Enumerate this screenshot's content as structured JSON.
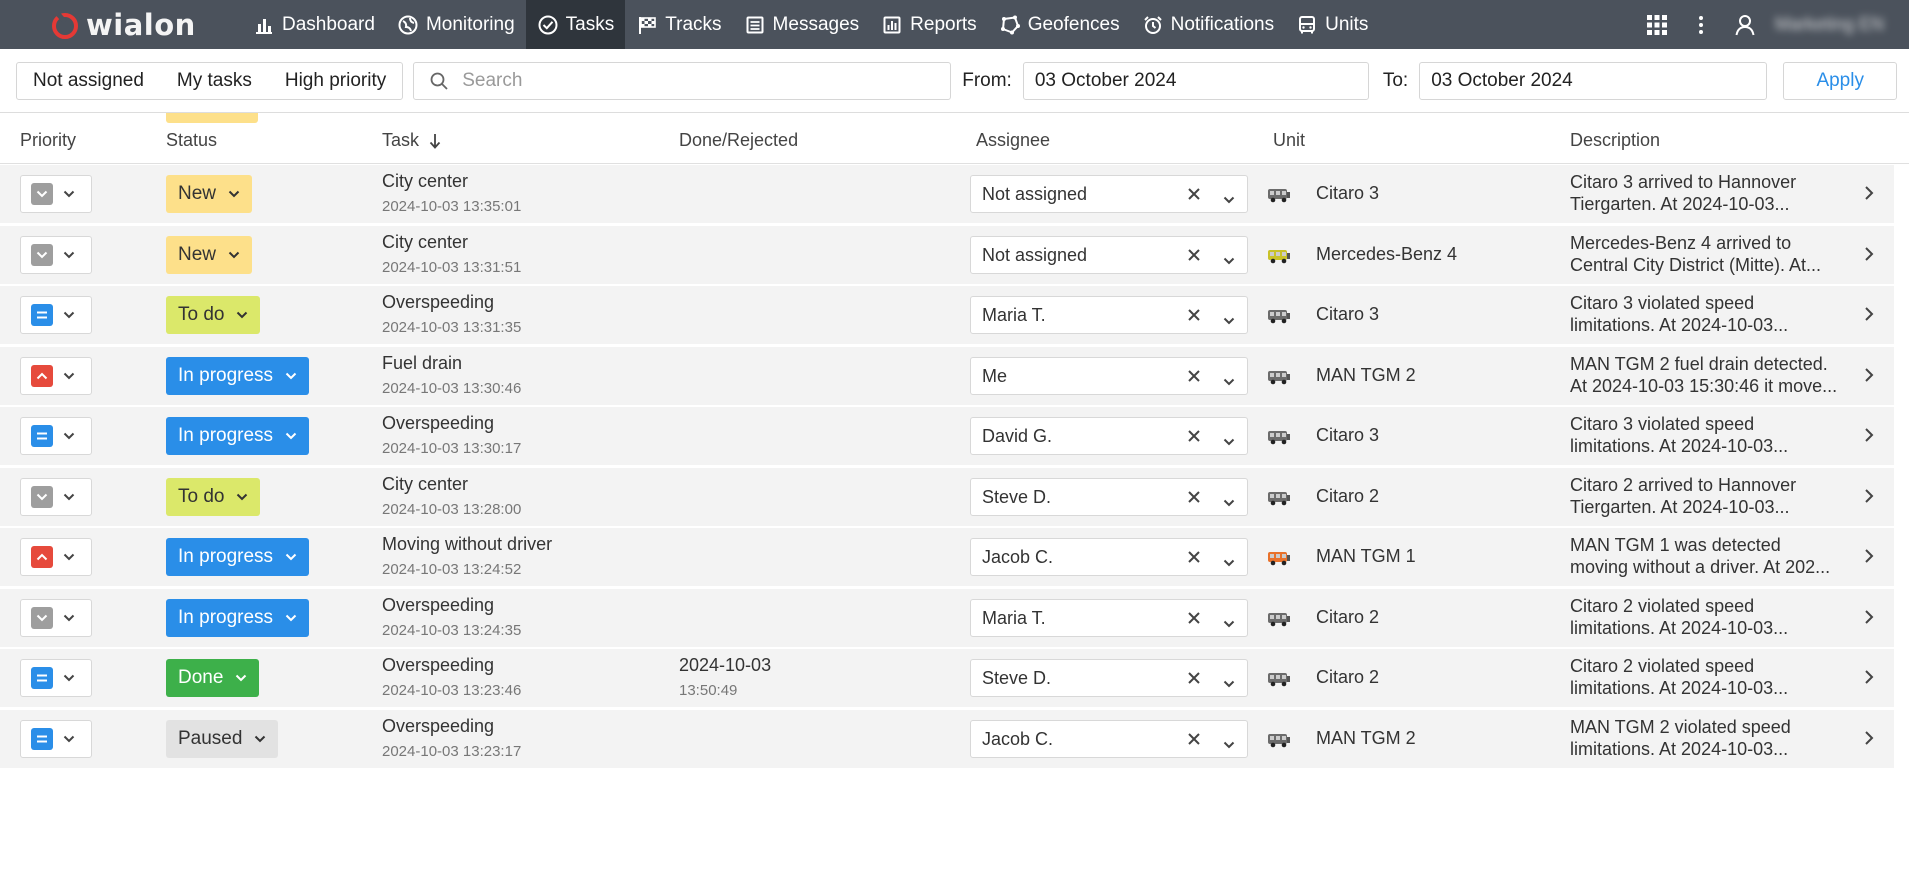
{
  "app": {
    "logo_text": "wialon",
    "nav": [
      {
        "label": "Dashboard",
        "icon": "dashboard-icon"
      },
      {
        "label": "Monitoring",
        "icon": "globe-icon"
      },
      {
        "label": "Tasks",
        "icon": "check-circle-icon"
      },
      {
        "label": "Tracks",
        "icon": "checkered-flag-icon"
      },
      {
        "label": "Messages",
        "icon": "messages-icon"
      },
      {
        "label": "Reports",
        "icon": "reports-icon"
      },
      {
        "label": "Geofences",
        "icon": "geofence-icon"
      },
      {
        "label": "Notifications",
        "icon": "alarm-clock-icon"
      },
      {
        "label": "Units",
        "icon": "bus-icon"
      }
    ],
    "active_nav": "Tasks",
    "user_name": "Marketing EN"
  },
  "filters": {
    "quick": [
      "Not assigned",
      "My tasks",
      "High priority"
    ],
    "search_placeholder": "Search",
    "from_label": "From:",
    "from_value": "03 October 2024",
    "to_label": "To:",
    "to_value": "03 October 2024",
    "apply_label": "Apply"
  },
  "table": {
    "columns": {
      "priority": "Priority",
      "status": "Status",
      "task": "Task",
      "done": "Done/Rejected",
      "assignee": "Assignee",
      "unit": "Unit",
      "description": "Description"
    },
    "sort_column": "Task",
    "sort_direction": "descending",
    "rows": [
      {
        "priority": "low",
        "status": "New",
        "task": "City center",
        "date": "2024-10-03 13:35:01",
        "done_date": "",
        "done_time": "",
        "assignee": "Not assigned",
        "unit": "Citaro 3",
        "desc1": "Citaro 3 arrived to Hannover",
        "desc2": "Tiergarten. At 2024-10-03..."
      },
      {
        "priority": "low",
        "status": "New",
        "task": "City center",
        "date": "2024-10-03 13:31:51",
        "done_date": "",
        "done_time": "",
        "assignee": "Not assigned",
        "unit": "Mercedes-Benz 4",
        "desc1": "Mercedes-Benz 4 arrived to",
        "desc2": "Central City District (Mitte). At..."
      },
      {
        "priority": "medium",
        "status": "To do",
        "task": "Overspeeding",
        "date": "2024-10-03 13:31:35",
        "done_date": "",
        "done_time": "",
        "assignee": "Maria T.",
        "unit": "Citaro 3",
        "desc1": "Citaro 3 violated speed",
        "desc2": "limitations. At 2024-10-03..."
      },
      {
        "priority": "high",
        "status": "In progress",
        "task": "Fuel drain",
        "date": "2024-10-03 13:30:46",
        "done_date": "",
        "done_time": "",
        "assignee": "Me",
        "unit": "MAN TGM 2",
        "desc1": "MAN TGM 2 fuel drain detected.",
        "desc2": "At 2024-10-03 15:30:46 it move..."
      },
      {
        "priority": "medium",
        "status": "In progress",
        "task": "Overspeeding",
        "date": "2024-10-03 13:30:17",
        "done_date": "",
        "done_time": "",
        "assignee": "David G.",
        "unit": "Citaro 3",
        "desc1": "Citaro 3 violated speed",
        "desc2": "limitations. At 2024-10-03..."
      },
      {
        "priority": "low",
        "status": "To do",
        "task": "City center",
        "date": "2024-10-03 13:28:00",
        "done_date": "",
        "done_time": "",
        "assignee": "Steve D.",
        "unit": "Citaro 2",
        "desc1": "Citaro 2 arrived to Hannover",
        "desc2": "Tiergarten. At 2024-10-03..."
      },
      {
        "priority": "high",
        "status": "In progress",
        "task": "Moving without driver",
        "date": "2024-10-03 13:24:52",
        "done_date": "",
        "done_time": "",
        "assignee": "Jacob C.",
        "unit": "MAN TGM 1",
        "desc1": "MAN TGM 1 was detected",
        "desc2": "moving without a driver. At 202..."
      },
      {
        "priority": "low",
        "status": "In progress",
        "task": "Overspeeding",
        "date": "2024-10-03 13:24:35",
        "done_date": "",
        "done_time": "",
        "assignee": "Maria T.",
        "unit": "Citaro 2",
        "desc1": "Citaro 2 violated speed",
        "desc2": "limitations. At 2024-10-03..."
      },
      {
        "priority": "medium",
        "status": "Done",
        "task": "Overspeeding",
        "date": "2024-10-03 13:23:46",
        "done_date": "2024-10-03",
        "done_time": "13:50:49",
        "assignee": "Steve D.",
        "unit": "Citaro 2",
        "desc1": "Citaro 2 violated speed",
        "desc2": "limitations. At 2024-10-03..."
      },
      {
        "priority": "medium",
        "status": "Paused",
        "task": "Overspeeding",
        "date": "2024-10-03 13:23:17",
        "done_date": "",
        "done_time": "",
        "assignee": "Jacob C.",
        "unit": "MAN TGM 2",
        "desc1": "MAN TGM 2 violated speed",
        "desc2": "limitations. At 2024-10-03..."
      }
    ]
  },
  "colors": {
    "nav_bg": "#4b525c",
    "nav_active": "#2f353c",
    "status_new": "#fde08a",
    "status_todo": "#dbe86a",
    "status_in_progress": "#2a8ee8",
    "status_done": "#3db04a",
    "status_paused": "#e2e2e2",
    "priority_low": "#9e9e9e",
    "priority_medium": "#2a8ee8",
    "priority_high": "#e64a3c",
    "accent": "#2a8ee8"
  }
}
